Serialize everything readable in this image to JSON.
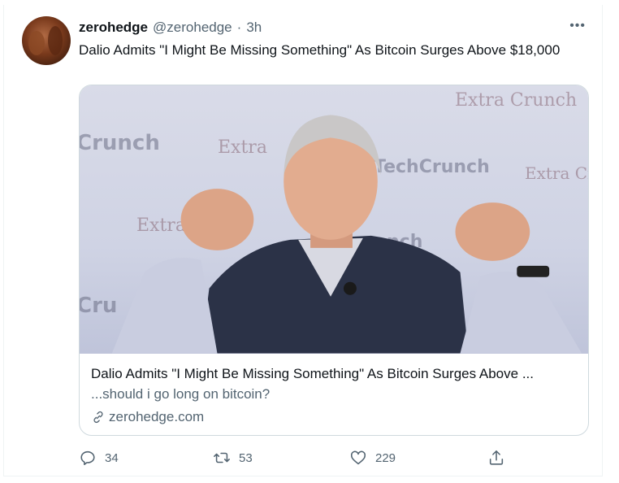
{
  "tweet": {
    "name": "zerohedge",
    "handle": "@zerohedge",
    "separator": "·",
    "time": "3h",
    "more": "•••",
    "text": "Dalio Admits \"I Might Be Missing Something\" As Bitcoin Surges Above $18,000"
  },
  "card": {
    "image_words": [
      "Crunch",
      "Extra",
      "TechCrunch",
      "Extra Cr",
      "Extra",
      "Extra Crunch",
      "Cru",
      "nch"
    ],
    "title": "Dalio Admits \"I Might Be Missing Something\" As Bitcoin Surges Above ...",
    "description": "...should i go long on bitcoin?",
    "domain": "zerohedge.com"
  },
  "actions": {
    "reply_count": "34",
    "retweet_count": "53",
    "like_count": "229"
  },
  "icons": {
    "reply": "reply-icon",
    "retweet": "retweet-icon",
    "like": "heart-icon",
    "share": "share-icon",
    "link": "link-icon",
    "more": "more-icon"
  },
  "colors": {
    "text_primary": "#0f1419",
    "text_secondary": "#536471",
    "border": "#cfd9de"
  }
}
